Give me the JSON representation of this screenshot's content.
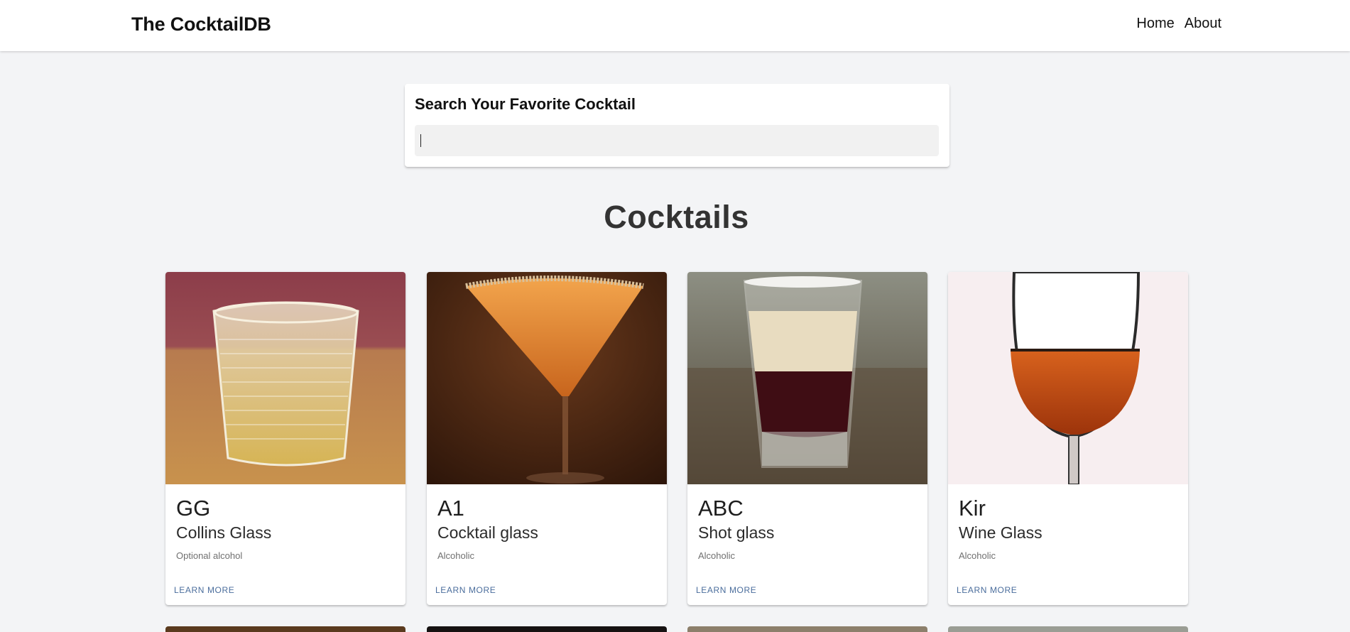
{
  "header": {
    "brand": "The CocktailDB",
    "nav": [
      {
        "label": "Home"
      },
      {
        "label": "About"
      }
    ]
  },
  "search": {
    "label": "Search Your Favorite Cocktail",
    "value": ""
  },
  "main": {
    "title": "Cocktails"
  },
  "cocktails": [
    {
      "name": "GG",
      "glass": "Collins Glass",
      "alcoholic": "Optional alcohol",
      "button": "Learn More"
    },
    {
      "name": "A1",
      "glass": "Cocktail glass",
      "alcoholic": "Alcoholic",
      "button": "Learn More"
    },
    {
      "name": "ABC",
      "glass": "Shot glass",
      "alcoholic": "Alcoholic",
      "button": "Learn More"
    },
    {
      "name": "Kir",
      "glass": "Wine Glass",
      "alcoholic": "Alcoholic",
      "button": "Learn More"
    }
  ],
  "colors": {
    "page_background": "#f3f4f6",
    "card_background": "#ffffff",
    "link": "#4a6d9c"
  }
}
